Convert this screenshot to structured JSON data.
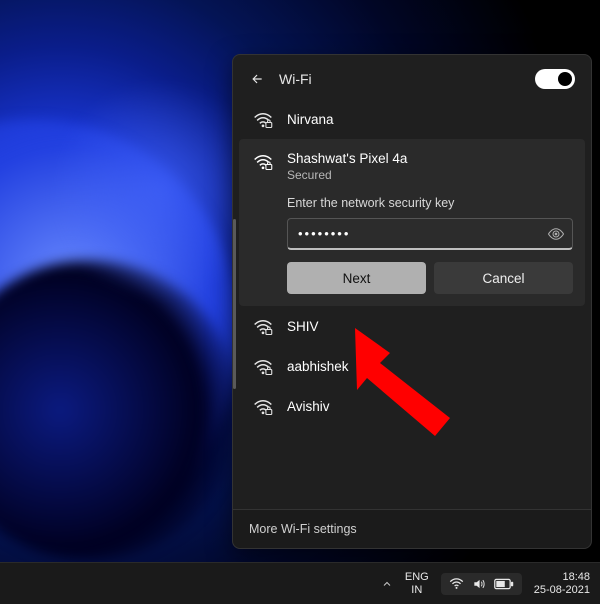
{
  "header": {
    "title": "Wi-Fi",
    "toggle_on": true
  },
  "networks": {
    "nirvana": {
      "name": "Nirvana",
      "secured": true
    },
    "selected": {
      "name": "Shashwat's Pixel 4a",
      "status": "Secured",
      "prompt": "Enter the network security key",
      "password_masked": "••••••••",
      "next_label": "Next",
      "cancel_label": "Cancel"
    },
    "shiv": {
      "name": "SHIV",
      "secured": true
    },
    "aabhishek": {
      "name": "aabhishek",
      "secured": true
    },
    "avishiv": {
      "name": "Avishiv",
      "secured": true
    }
  },
  "footer": {
    "more_settings": "More Wi-Fi settings"
  },
  "taskbar": {
    "lang_top": "ENG",
    "lang_bottom": "IN",
    "time": "18:48",
    "date": "25-08-2021"
  }
}
